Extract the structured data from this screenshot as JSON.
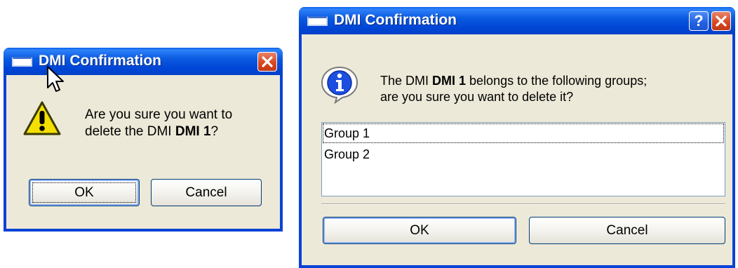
{
  "dialog1": {
    "title": "DMI Confirmation",
    "message_part1": "Are you sure you want to",
    "message_part2": "delete the DMI ",
    "message_bold": "DMI 1",
    "message_part3": "?",
    "icon": "warning-icon",
    "ok_label": "OK",
    "cancel_label": "Cancel"
  },
  "dialog2": {
    "title": "DMI Confirmation",
    "help_label": "?",
    "message_part1": "The DMI ",
    "message_bold": "DMI 1",
    "message_part2": " belongs to the following groups;",
    "message_line2": "are you sure you want to delete it?",
    "icon": "info-icon",
    "groups": [
      "Group 1",
      "Group 2"
    ],
    "ok_label": "OK",
    "cancel_label": "Cancel"
  },
  "colors": {
    "titlebar": "#0046d6",
    "dialog_bg": "#ece9d8",
    "close_button": "#d5461e"
  }
}
